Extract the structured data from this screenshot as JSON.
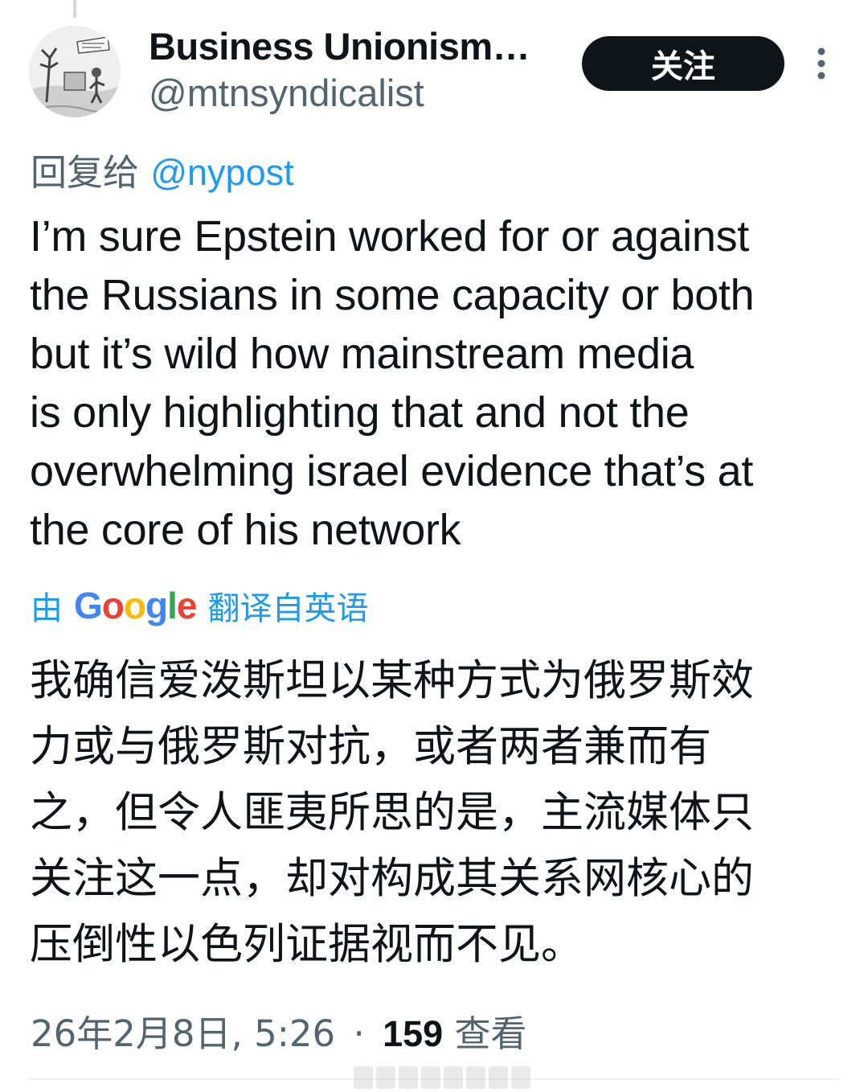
{
  "author": {
    "display_name": "Business Unionism…",
    "handle": "@mtnsyndicalist",
    "avatar_icon": "cartoon-avatar"
  },
  "follow_button": {
    "label": "关注"
  },
  "reply": {
    "prefix": "回复给",
    "mention": "@nypost"
  },
  "tweet_text_lines": [
    "I’m sure Epstein worked for or against",
    "the Russians in some capacity or both",
    "but it’s wild how mainstream media",
    "is only highlighting that and not the",
    "overwhelming israel evidence that’s at",
    "the core of his network"
  ],
  "translation": {
    "prefix": "由",
    "provider": "Google",
    "suffix": "翻译自英语",
    "lines": [
      "我确信爱泼斯坦以某种方式为俄罗斯效",
      "力或与俄罗斯对抗，或者两者兼而有",
      "之，但令人匪夷所思的是，主流媒体只",
      "关注这一点，却对构成其关系网核心的",
      "压倒性以色列证据视而不见。"
    ]
  },
  "meta": {
    "timestamp": "26年2月8日, 5:26",
    "separator": "·",
    "views_count": "159",
    "views_label": "查看"
  },
  "colors": {
    "text_primary": "#0f1419",
    "text_secondary": "#536471",
    "link": "#1d9bf0",
    "button_bg": "#0f1419",
    "google_blue": "#4285f4",
    "google_red": "#ea4335",
    "google_yellow": "#fbbc05",
    "google_green": "#34a853"
  }
}
